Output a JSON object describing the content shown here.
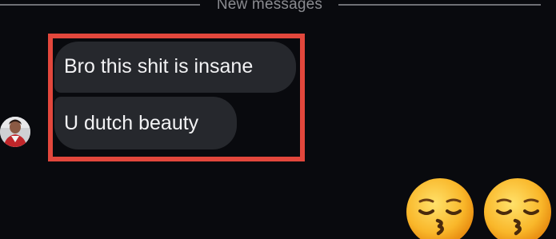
{
  "divider": {
    "label": "New messages"
  },
  "messages": [
    {
      "text": "Bro this shit is insane"
    },
    {
      "text": "U dutch beauty"
    }
  ],
  "sender": {
    "avatar_icon": "profile-photo"
  },
  "reactions": [
    {
      "icon": "kissing-face-with-closed-eyes-emoji"
    },
    {
      "icon": "kissing-face-with-closed-eyes-emoji"
    }
  ],
  "colors": {
    "background": "#090a0e",
    "bubble": "#26282d",
    "bubble_text": "#f2f2f4",
    "highlight_border": "#e2473c",
    "divider": "#6f7075"
  }
}
